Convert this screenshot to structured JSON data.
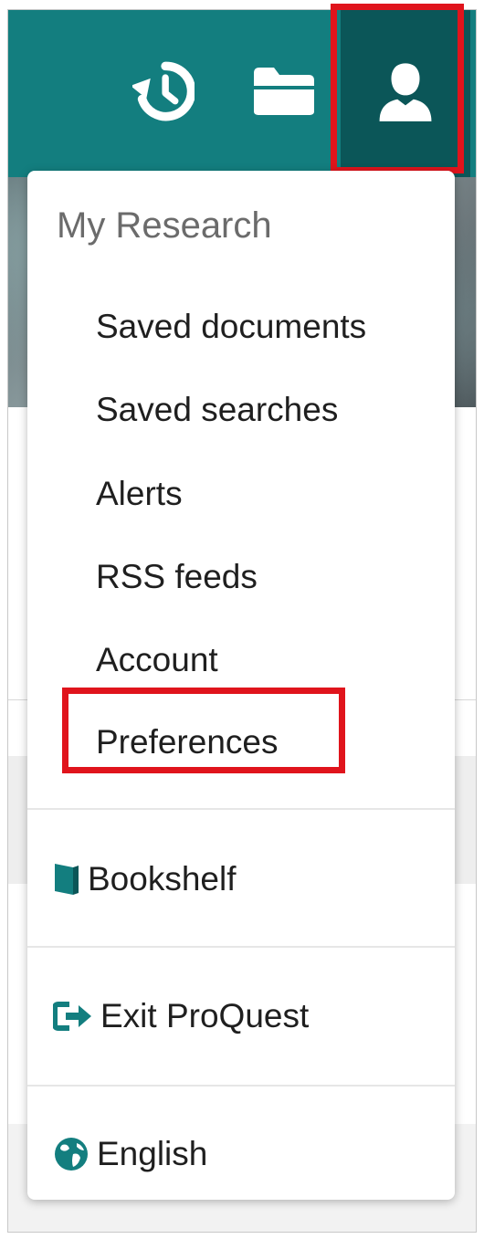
{
  "toolbar": {
    "icons": [
      "history-icon",
      "folder-icon",
      "user-icon"
    ]
  },
  "menu": {
    "heading": "My Research",
    "items": [
      {
        "label": "Saved documents"
      },
      {
        "label": "Saved searches"
      },
      {
        "label": "Alerts"
      },
      {
        "label": "RSS feeds"
      },
      {
        "label": "Account"
      },
      {
        "label": "Preferences"
      }
    ],
    "bookshelf": {
      "label": "Bookshelf",
      "icon": "book-icon"
    },
    "exit": {
      "label": "Exit ProQuest",
      "icon": "exit-icon"
    },
    "language": {
      "label": "English",
      "icon": "globe-icon"
    }
  },
  "colors": {
    "topbar": "#137e7f",
    "active_button": "#0b5658",
    "highlight": "#e0141c",
    "icon_accent": "#137e7f"
  }
}
